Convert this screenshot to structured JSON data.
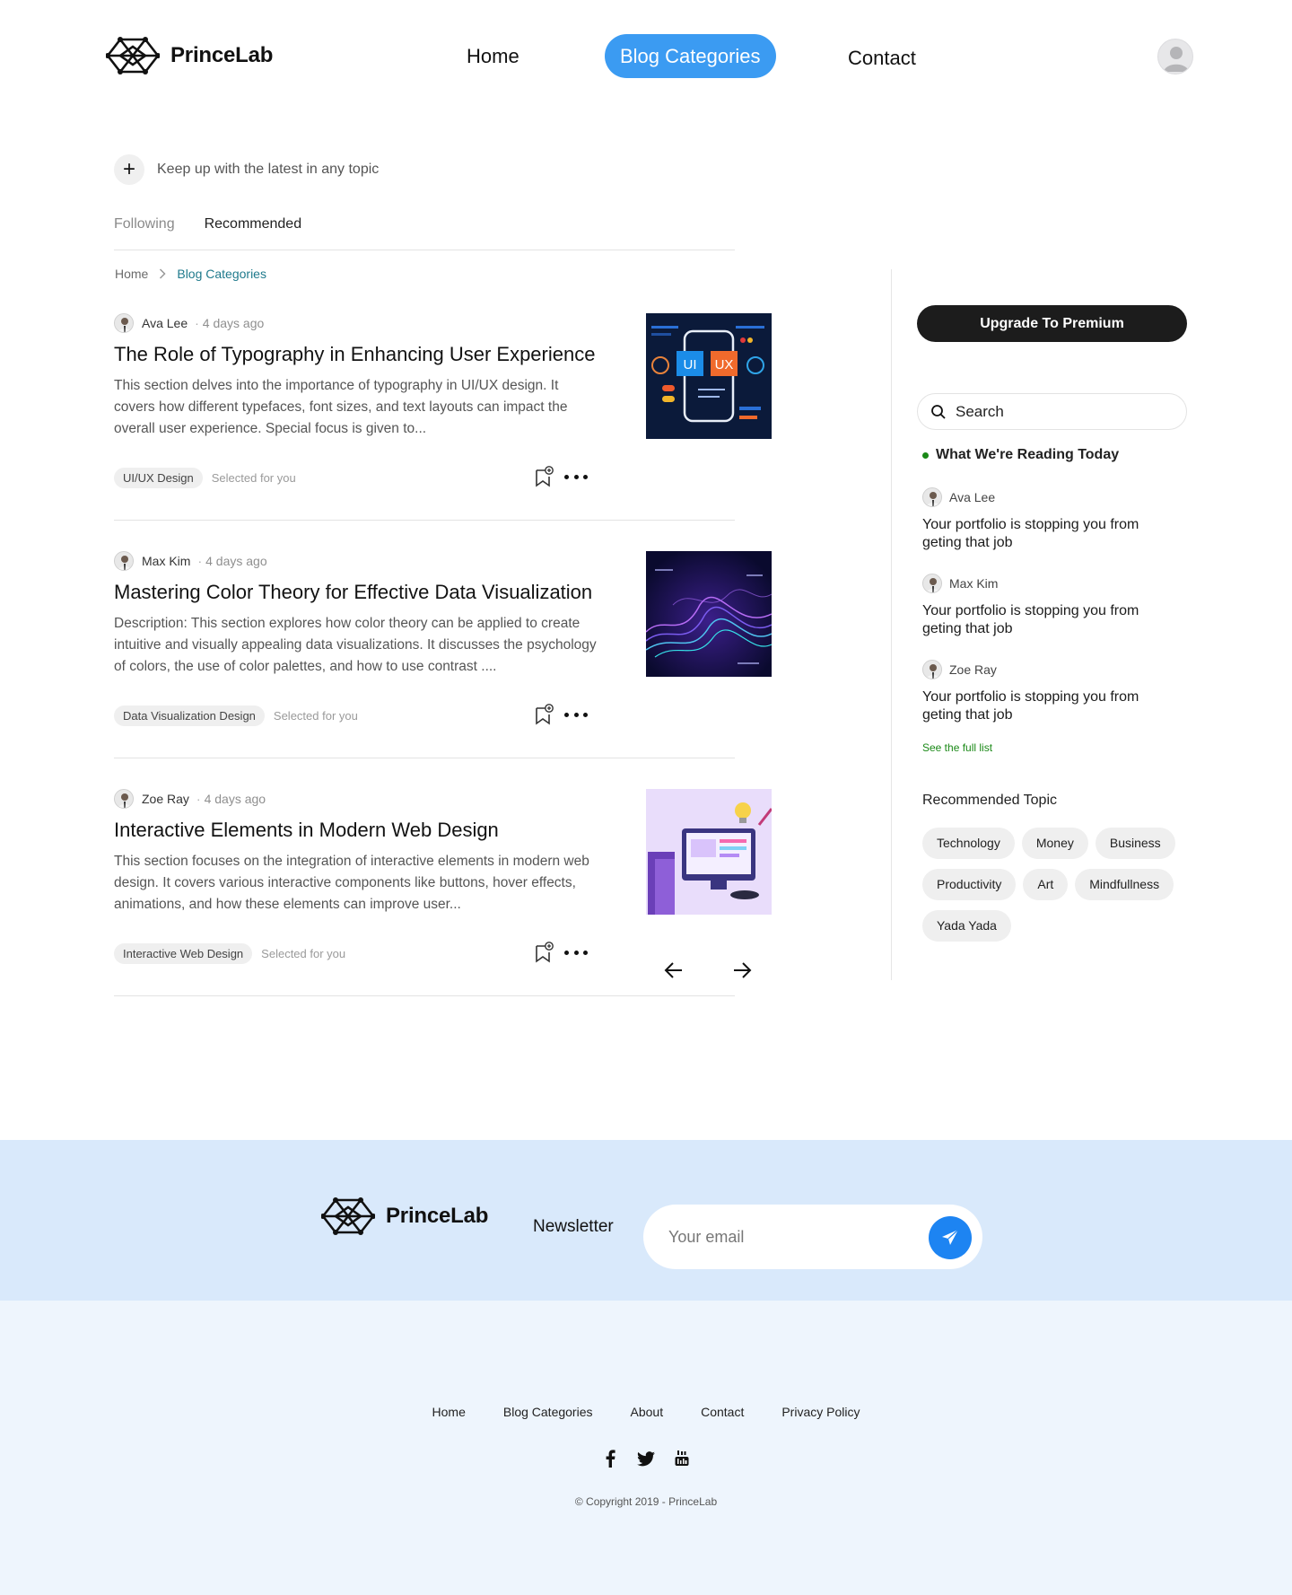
{
  "header": {
    "brand": "PrinceLab",
    "nav": {
      "home": "Home",
      "blog": "Blog Categories",
      "contact": "Contact"
    }
  },
  "topics_strip": {
    "follow_text": "Keep up with the latest in any topic"
  },
  "tabs": [
    "Following",
    "Recommended"
  ],
  "breadcrumb": {
    "home": "Home",
    "current": "Blog Categories"
  },
  "articles": [
    {
      "author": "Ava Lee",
      "ago": "4 days ago",
      "title": "The Role of Typography in Enhancing User Experience",
      "description": "This section delves into the importance of typography in UI/UX design. It covers how different typefaces, font sizes, and text layouts can impact the overall user experience. Special focus is given to...",
      "tag": "UI/UX Design",
      "selected": "Selected for you",
      "thumb_labels": [
        "UI",
        "UX"
      ]
    },
    {
      "author": "Max Kim",
      "ago": "4 days ago",
      "title": "Mastering Color Theory for Effective Data Visualization",
      "description": "Description: This section explores how color theory can be applied to create intuitive and visually appealing data visualizations. It discusses the psychology of colors, the use of color palettes, and how to use contrast ....",
      "tag": "Data Visualization Design",
      "selected": "Selected for you"
    },
    {
      "author": "Zoe Ray",
      "ago": "4 days ago",
      "title": "Interactive Elements in Modern Web Design",
      "description": "This section focuses on the integration of interactive elements in modern web design. It covers various interactive components like buttons, hover effects, animations, and how these elements can improve user...",
      "tag": "Interactive Web Design",
      "selected": "Selected for you"
    }
  ],
  "sidebar": {
    "premium": "Upgrade To Premium",
    "search_placeholder": "Search",
    "reading_title": "What We're Reading Today",
    "reading": [
      {
        "author": "Ava Lee",
        "title": "Your portfolio is stopping you from geting that job"
      },
      {
        "author": "Max Kim",
        "title": "Your portfolio is stopping you from geting that job"
      },
      {
        "author": "Zoe Ray",
        "title": "Your portfolio is stopping you from geting that job"
      }
    ],
    "full_list": "See the full list",
    "recommended_title": "Recommended Topic",
    "topics": [
      "Technology",
      "Money",
      "Business",
      "Productivity",
      "Art",
      "Mindfullness",
      "Yada Yada"
    ]
  },
  "newsletter": {
    "brand": "PrinceLab",
    "label": "Newsletter",
    "placeholder": "Your email"
  },
  "footer": {
    "links": [
      "Home",
      "Blog Categories",
      "About",
      "Contact",
      "Privacy Policy"
    ],
    "socials": [
      "facebook-icon",
      "twitter-icon",
      "youtube-icon"
    ],
    "copyright": "© Copyright 2019 - PrinceLab"
  },
  "colors": {
    "accent": "#3b9bf2",
    "send": "#1d84f2",
    "newsletter_bg": "#d9e9fb",
    "footer_bg": "#eef5fd",
    "green": "#1a8917"
  }
}
